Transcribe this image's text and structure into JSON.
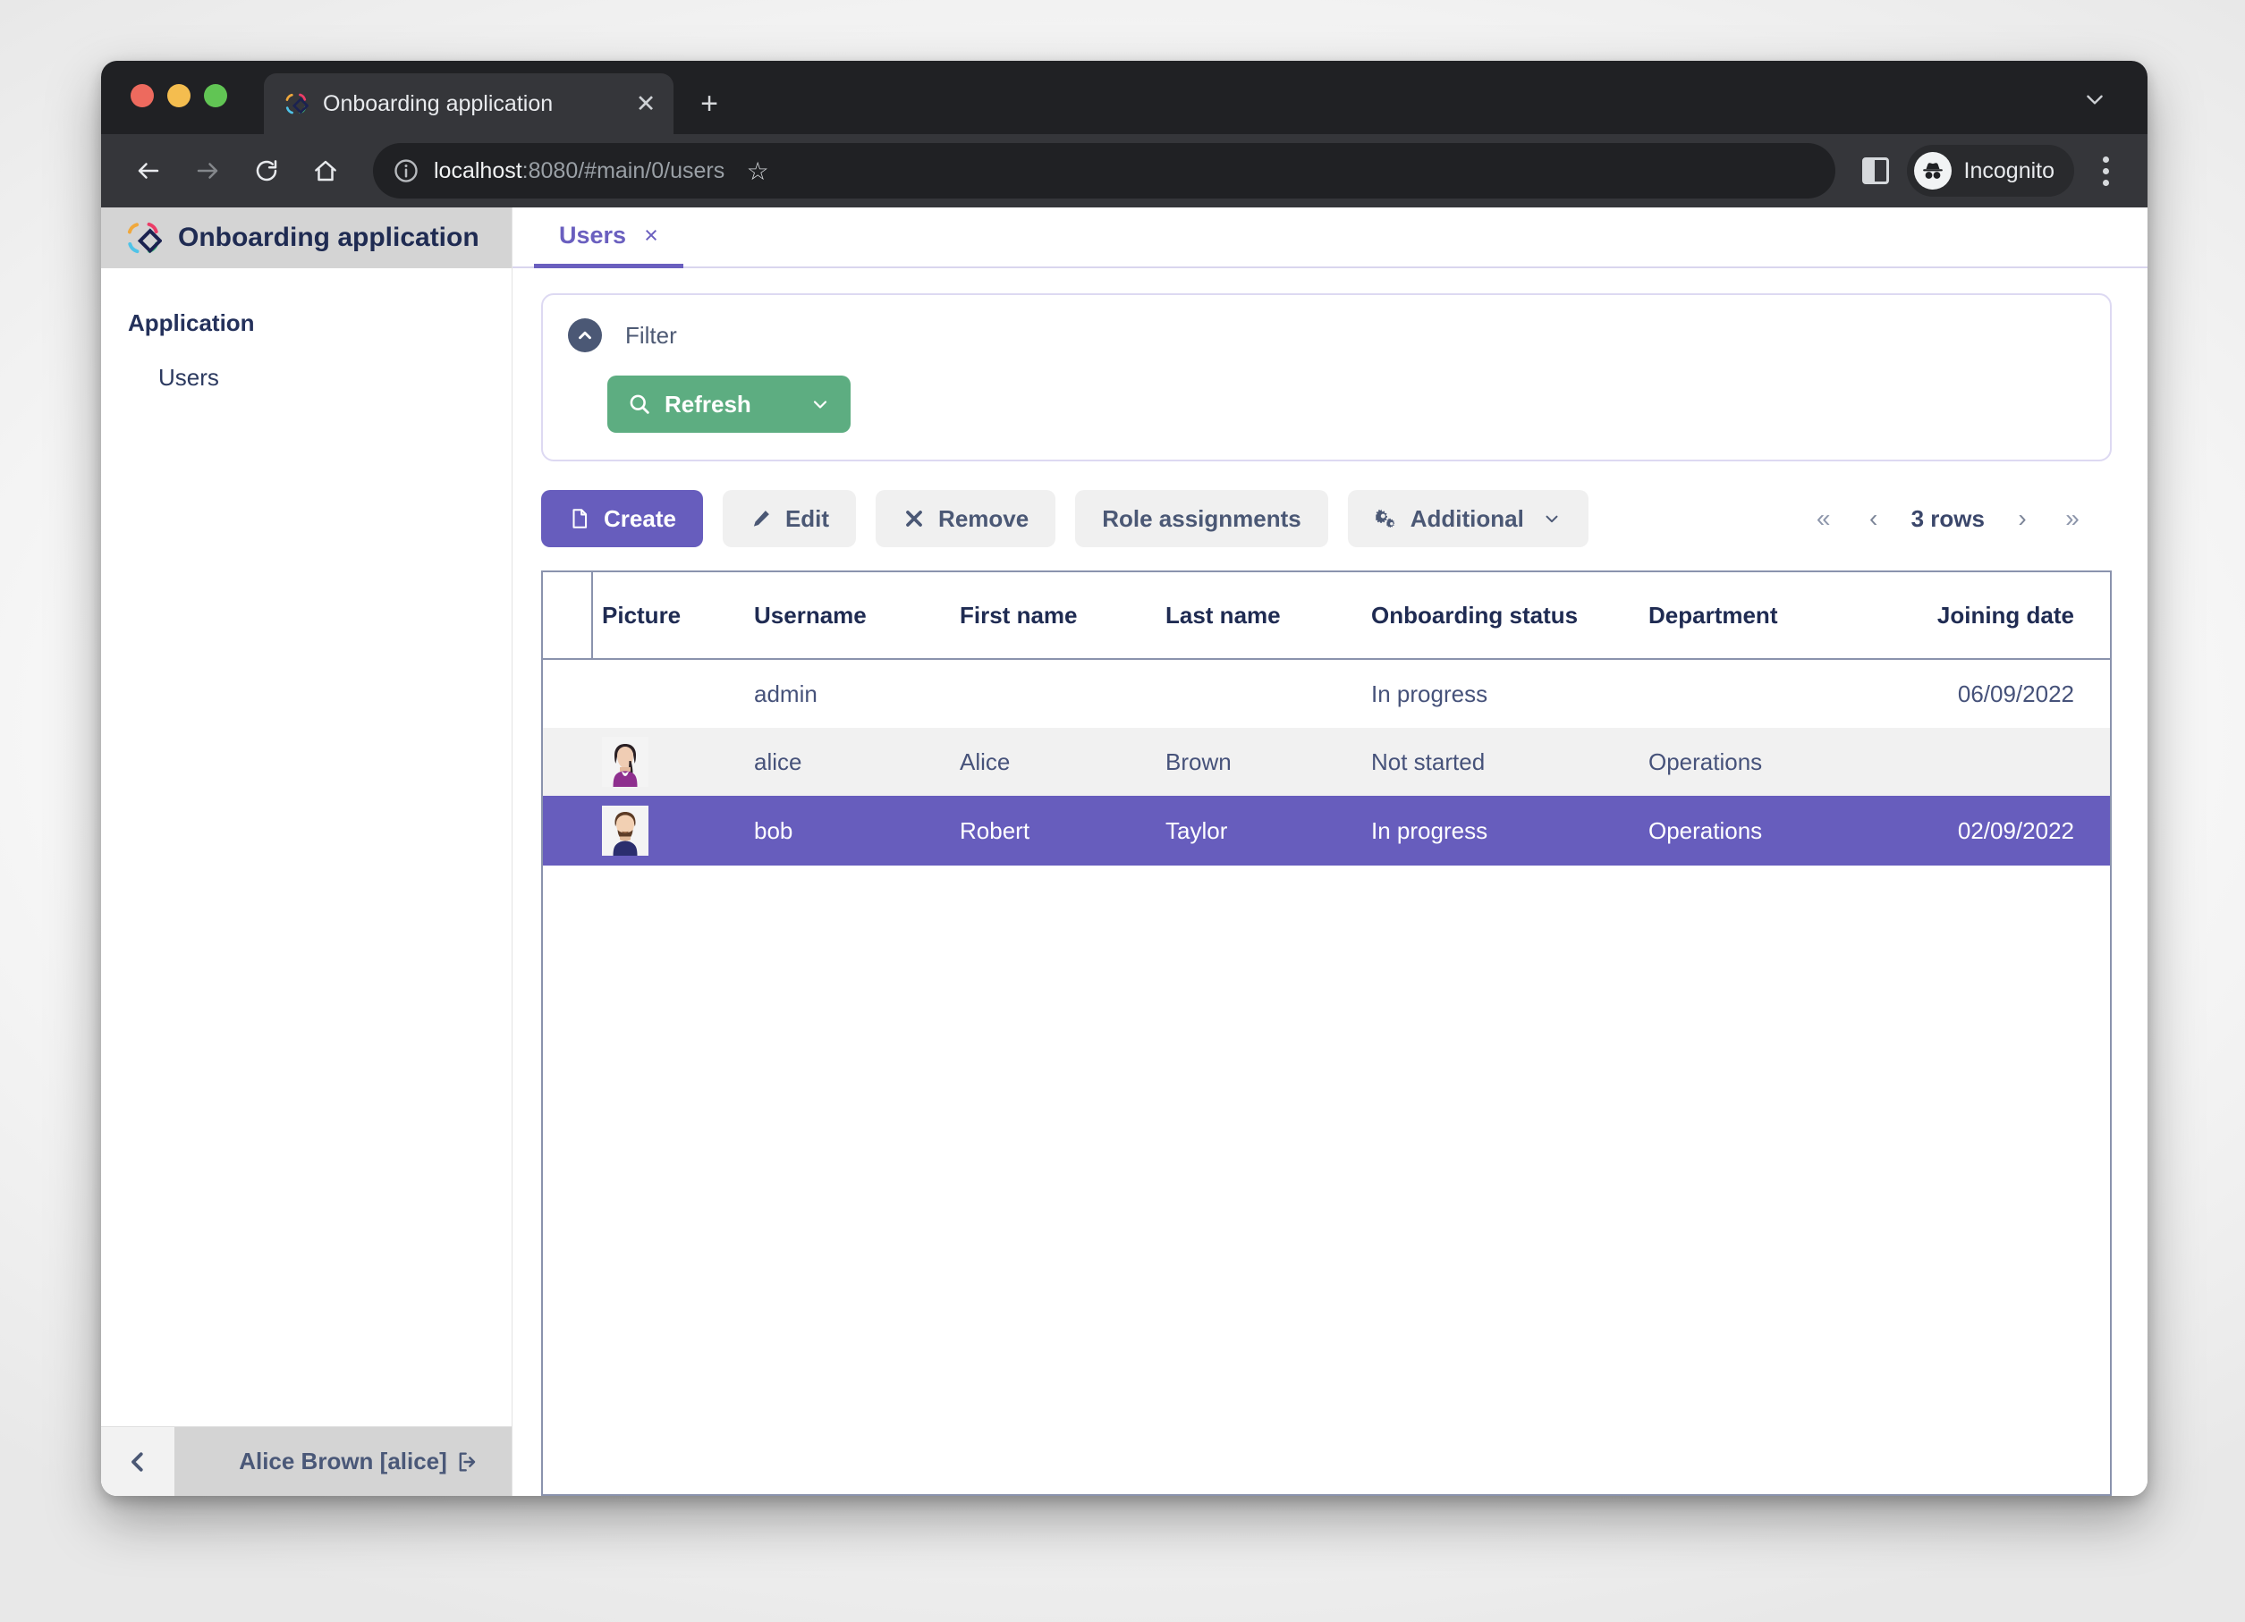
{
  "browser": {
    "tab": {
      "title": "Onboarding application",
      "favicon": "app-logo-icon",
      "close": "✕"
    },
    "new_tab": "+",
    "tabstrip_caret": "⌄",
    "nav": {
      "back": "←",
      "forward": "→",
      "reload": "↻",
      "home": "⌂"
    },
    "omnibox": {
      "host": "localhost",
      "rest": ":8080/#main/0/users",
      "info_icon": "info-icon"
    },
    "star": "☆",
    "profile_label": "Incognito",
    "menu": "kebab-menu-icon"
  },
  "sidebar": {
    "app_title": "Onboarding application",
    "group_label": "Application",
    "items": [
      {
        "label": "Users"
      }
    ],
    "collapse": "❮",
    "user": {
      "name": "Alice Brown [alice]",
      "logout_icon": "logout-icon"
    }
  },
  "main": {
    "tabs": [
      {
        "label": "Users",
        "close": "×"
      }
    ],
    "filter": {
      "label": "Filter",
      "collapse_icon": "chevron-up-icon",
      "refresh_label": "Refresh",
      "refresh_caret": "⌄",
      "search_icon": "search-icon"
    },
    "actions": {
      "create": "Create",
      "edit": "Edit",
      "remove": "Remove",
      "role_assignments": "Role assignments",
      "additional": "Additional",
      "additional_caret": "⌄"
    },
    "pager": {
      "first": "«",
      "prev": "‹",
      "count": "3 rows",
      "next": "›",
      "last": "»"
    },
    "grid": {
      "columns": [
        "Picture",
        "Username",
        "First name",
        "Last name",
        "Onboarding status",
        "Department",
        "Joining date"
      ],
      "rows": [
        {
          "picture": "",
          "username": "admin",
          "first_name": "",
          "last_name": "",
          "status": "In progress",
          "department": "",
          "joining_date": "06/09/2022",
          "selected": false,
          "striped": false
        },
        {
          "picture": "avatar-alice",
          "username": "alice",
          "first_name": "Alice",
          "last_name": "Brown",
          "status": "Not started",
          "department": "Operations",
          "joining_date": "",
          "selected": false,
          "striped": true
        },
        {
          "picture": "avatar-bob",
          "username": "bob",
          "first_name": "Robert",
          "last_name": "Taylor",
          "status": "In progress",
          "department": "Operations",
          "joining_date": "02/09/2022",
          "selected": true,
          "striped": false
        }
      ]
    }
  },
  "colors": {
    "primary_purple": "#675DBD",
    "accent_purple": "#6A5FBF",
    "refresh_green": "#5DAD81",
    "header_grey": "#D4D4D4",
    "text_navy": "#1F2B52",
    "grid_border": "#8A93AD"
  }
}
